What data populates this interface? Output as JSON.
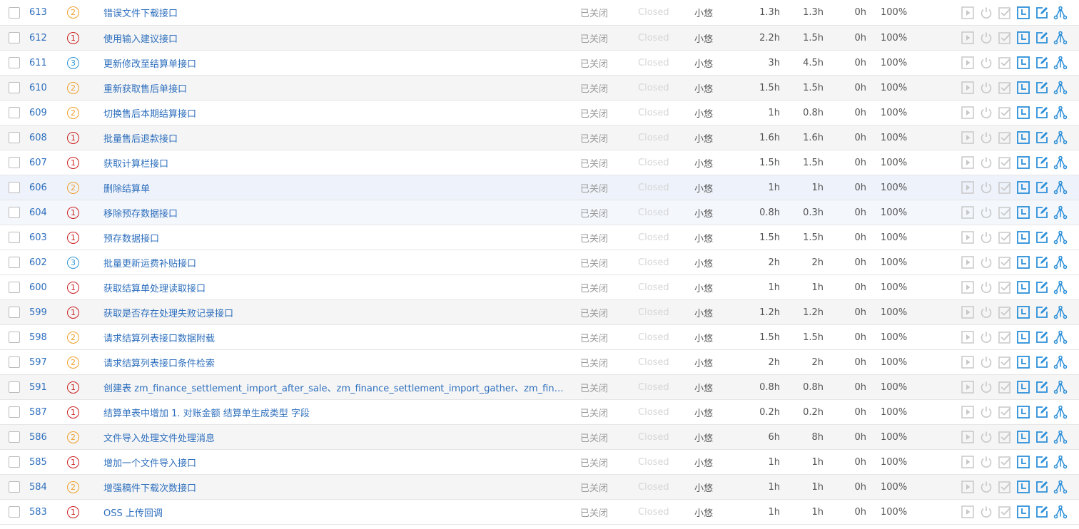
{
  "colors": {
    "link": "#2e6fbd",
    "priority1": "#cc1f1f",
    "priority2": "#f0a02a",
    "priority3": "#2f95d6",
    "action_active": "#2b8fd9",
    "action_disabled": "#c8c8c8"
  },
  "actions": [
    {
      "name": "start-icon",
      "enabled": false
    },
    {
      "name": "power-icon",
      "enabled": false
    },
    {
      "name": "finish-check-icon",
      "enabled": false
    },
    {
      "name": "record-estimate-icon",
      "enabled": true
    },
    {
      "name": "edit-icon",
      "enabled": true
    },
    {
      "name": "split-branch-icon",
      "enabled": true
    }
  ],
  "rows": [
    {
      "id": "613",
      "priority": "2",
      "title": "错误文件下载接口",
      "status": "已关闭",
      "status_en": "Closed",
      "assignee": "小悠",
      "estimate": "1.3h",
      "consumed": "1.3h",
      "left": "0h",
      "progress": "100%"
    },
    {
      "id": "612",
      "priority": "1",
      "title": "使用输入建议接口",
      "status": "已关闭",
      "status_en": "Closed",
      "assignee": "小悠",
      "estimate": "2.2h",
      "consumed": "1.5h",
      "left": "0h",
      "progress": "100%"
    },
    {
      "id": "611",
      "priority": "3",
      "title": "更新修改至结算单接口",
      "status": "已关闭",
      "status_en": "Closed",
      "assignee": "小悠",
      "estimate": "3h",
      "consumed": "4.5h",
      "left": "0h",
      "progress": "100%"
    },
    {
      "id": "610",
      "priority": "2",
      "title": "重新获取售后单接口",
      "status": "已关闭",
      "status_en": "Closed",
      "assignee": "小悠",
      "estimate": "1.5h",
      "consumed": "1.5h",
      "left": "0h",
      "progress": "100%"
    },
    {
      "id": "609",
      "priority": "2",
      "title": "切换售后本期结算接口",
      "status": "已关闭",
      "status_en": "Closed",
      "assignee": "小悠",
      "estimate": "1h",
      "consumed": "0.8h",
      "left": "0h",
      "progress": "100%"
    },
    {
      "id": "608",
      "priority": "1",
      "title": "批量售后退款接口",
      "status": "已关闭",
      "status_en": "Closed",
      "assignee": "小悠",
      "estimate": "1.6h",
      "consumed": "1.6h",
      "left": "0h",
      "progress": "100%"
    },
    {
      "id": "607",
      "priority": "1",
      "title": "获取计算栏接口",
      "status": "已关闭",
      "status_en": "Closed",
      "assignee": "小悠",
      "estimate": "1.5h",
      "consumed": "1.5h",
      "left": "0h",
      "progress": "100%"
    },
    {
      "id": "606",
      "priority": "2",
      "title": "删除结算单",
      "status": "已关闭",
      "status_en": "Closed",
      "assignee": "小悠",
      "estimate": "1h",
      "consumed": "1h",
      "left": "0h",
      "progress": "100%"
    },
    {
      "id": "604",
      "priority": "1",
      "title": "移除预存数据接口",
      "status": "已关闭",
      "status_en": "Closed",
      "assignee": "小悠",
      "estimate": "0.8h",
      "consumed": "0.3h",
      "left": "0h",
      "progress": "100%"
    },
    {
      "id": "603",
      "priority": "1",
      "title": "预存数据接口",
      "status": "已关闭",
      "status_en": "Closed",
      "assignee": "小悠",
      "estimate": "1.5h",
      "consumed": "1.5h",
      "left": "0h",
      "progress": "100%"
    },
    {
      "id": "602",
      "priority": "3",
      "title": "批量更新运费补贴接口",
      "status": "已关闭",
      "status_en": "Closed",
      "assignee": "小悠",
      "estimate": "2h",
      "consumed": "2h",
      "left": "0h",
      "progress": "100%"
    },
    {
      "id": "600",
      "priority": "1",
      "title": "获取结算单处理读取接口",
      "status": "已关闭",
      "status_en": "Closed",
      "assignee": "小悠",
      "estimate": "1h",
      "consumed": "1h",
      "left": "0h",
      "progress": "100%"
    },
    {
      "id": "599",
      "priority": "1",
      "title": "获取是否存在处理失败记录接口",
      "status": "已关闭",
      "status_en": "Closed",
      "assignee": "小悠",
      "estimate": "1.2h",
      "consumed": "1.2h",
      "left": "0h",
      "progress": "100%"
    },
    {
      "id": "598",
      "priority": "2",
      "title": "请求结算列表接口数据附载",
      "status": "已关闭",
      "status_en": "Closed",
      "assignee": "小悠",
      "estimate": "1.5h",
      "consumed": "1.5h",
      "left": "0h",
      "progress": "100%"
    },
    {
      "id": "597",
      "priority": "2",
      "title": "请求结算列表接口条件检索",
      "status": "已关闭",
      "status_en": "Closed",
      "assignee": "小悠",
      "estimate": "2h",
      "consumed": "2h",
      "left": "0h",
      "progress": "100%"
    },
    {
      "id": "591",
      "priority": "1",
      "title": "创建表 zm_finance_settlement_import_after_sale、zm_finance_settlement_import_gather、zm_finance_settle…",
      "status": "已关闭",
      "status_en": "Closed",
      "assignee": "小悠",
      "estimate": "0.8h",
      "consumed": "0.8h",
      "left": "0h",
      "progress": "100%"
    },
    {
      "id": "587",
      "priority": "1",
      "title": "结算单表中增加 1. 对账金额 结算单生成类型 字段",
      "status": "已关闭",
      "status_en": "Closed",
      "assignee": "小悠",
      "estimate": "0.2h",
      "consumed": "0.2h",
      "left": "0h",
      "progress": "100%"
    },
    {
      "id": "586",
      "priority": "2",
      "title": "文件导入处理文件处理消息",
      "status": "已关闭",
      "status_en": "Closed",
      "assignee": "小悠",
      "estimate": "6h",
      "consumed": "8h",
      "left": "0h",
      "progress": "100%"
    },
    {
      "id": "585",
      "priority": "1",
      "title": "增加一个文件导入接口",
      "status": "已关闭",
      "status_en": "Closed",
      "assignee": "小悠",
      "estimate": "1h",
      "consumed": "1h",
      "left": "0h",
      "progress": "100%"
    },
    {
      "id": "584",
      "priority": "2",
      "title": "增强稿件下载次数接口",
      "status": "已关闭",
      "status_en": "Closed",
      "assignee": "小悠",
      "estimate": "1h",
      "consumed": "1h",
      "left": "0h",
      "progress": "100%"
    },
    {
      "id": "583",
      "priority": "1",
      "title": "OSS 上传回调",
      "status": "已关闭",
      "status_en": "Closed",
      "assignee": "小悠",
      "estimate": "1h",
      "consumed": "1h",
      "left": "0h",
      "progress": "100%"
    }
  ]
}
